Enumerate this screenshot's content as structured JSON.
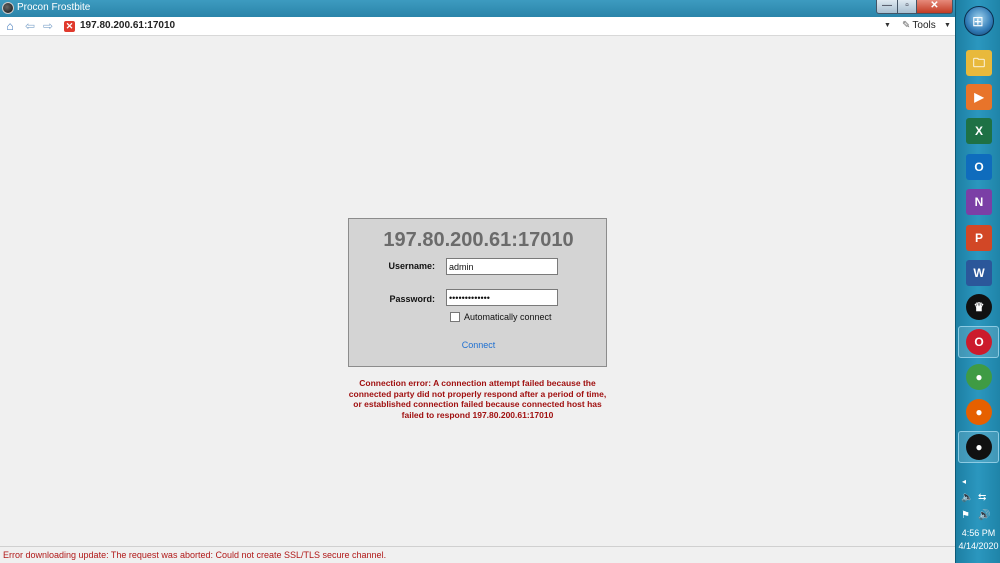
{
  "window": {
    "title": "Procon Frostbite",
    "minimize_glyph": "—",
    "maximize_glyph": "▫",
    "close_glyph": "✕"
  },
  "toolbar": {
    "address": "197.80.200.61:17010",
    "tools_label": "Tools",
    "icons": [
      "home-icon",
      "back-arrow-icon",
      "forward-arrow-icon",
      "error-icon",
      "dropdown-icon",
      "wrench-icon"
    ]
  },
  "login": {
    "server_title": "197.80.200.61:17010",
    "username_label": "Username:",
    "username_value": "admin",
    "password_label": "Password:",
    "password_value": "•••••••••••••",
    "auto_connect_label": "Automatically connect",
    "auto_connect_checked": false,
    "connect_label": "Connect"
  },
  "connection_error": "Connection error: A connection attempt failed because the connected party did not properly respond after a period of time, or established connection failed because connected host has failed to respond 197.80.200.61:17010",
  "status_bar": {
    "text": "Error downloading update: The request was aborted: Could not create SSL/TLS secure channel."
  },
  "taskbar": {
    "apps": [
      {
        "name": "file-explorer-icon",
        "glyph": "🗀",
        "color": "#e8b93c"
      },
      {
        "name": "media-player-icon",
        "glyph": "▶",
        "color": "#e8742a"
      },
      {
        "name": "excel-icon",
        "glyph": "X",
        "color": "#1e7145"
      },
      {
        "name": "outlook-icon",
        "glyph": "O",
        "color": "#0f6cbd"
      },
      {
        "name": "onenote-icon",
        "glyph": "N",
        "color": "#7b3fa6"
      },
      {
        "name": "powerpoint-icon",
        "glyph": "P",
        "color": "#d24726"
      },
      {
        "name": "word-icon",
        "glyph": "W",
        "color": "#2b579a"
      },
      {
        "name": "crown-app-icon",
        "glyph": "♛",
        "color": "#111111"
      },
      {
        "name": "opera-icon",
        "glyph": "O",
        "color": "#cc1b2c"
      },
      {
        "name": "chrome-icon",
        "glyph": "●",
        "color": "#3f9b44"
      },
      {
        "name": "firefox-icon",
        "glyph": "●",
        "color": "#e66000"
      },
      {
        "name": "procon-icon",
        "glyph": "●",
        "color": "#111111"
      }
    ],
    "clock_time": "4:56 PM",
    "clock_date": "4/14/2020"
  }
}
